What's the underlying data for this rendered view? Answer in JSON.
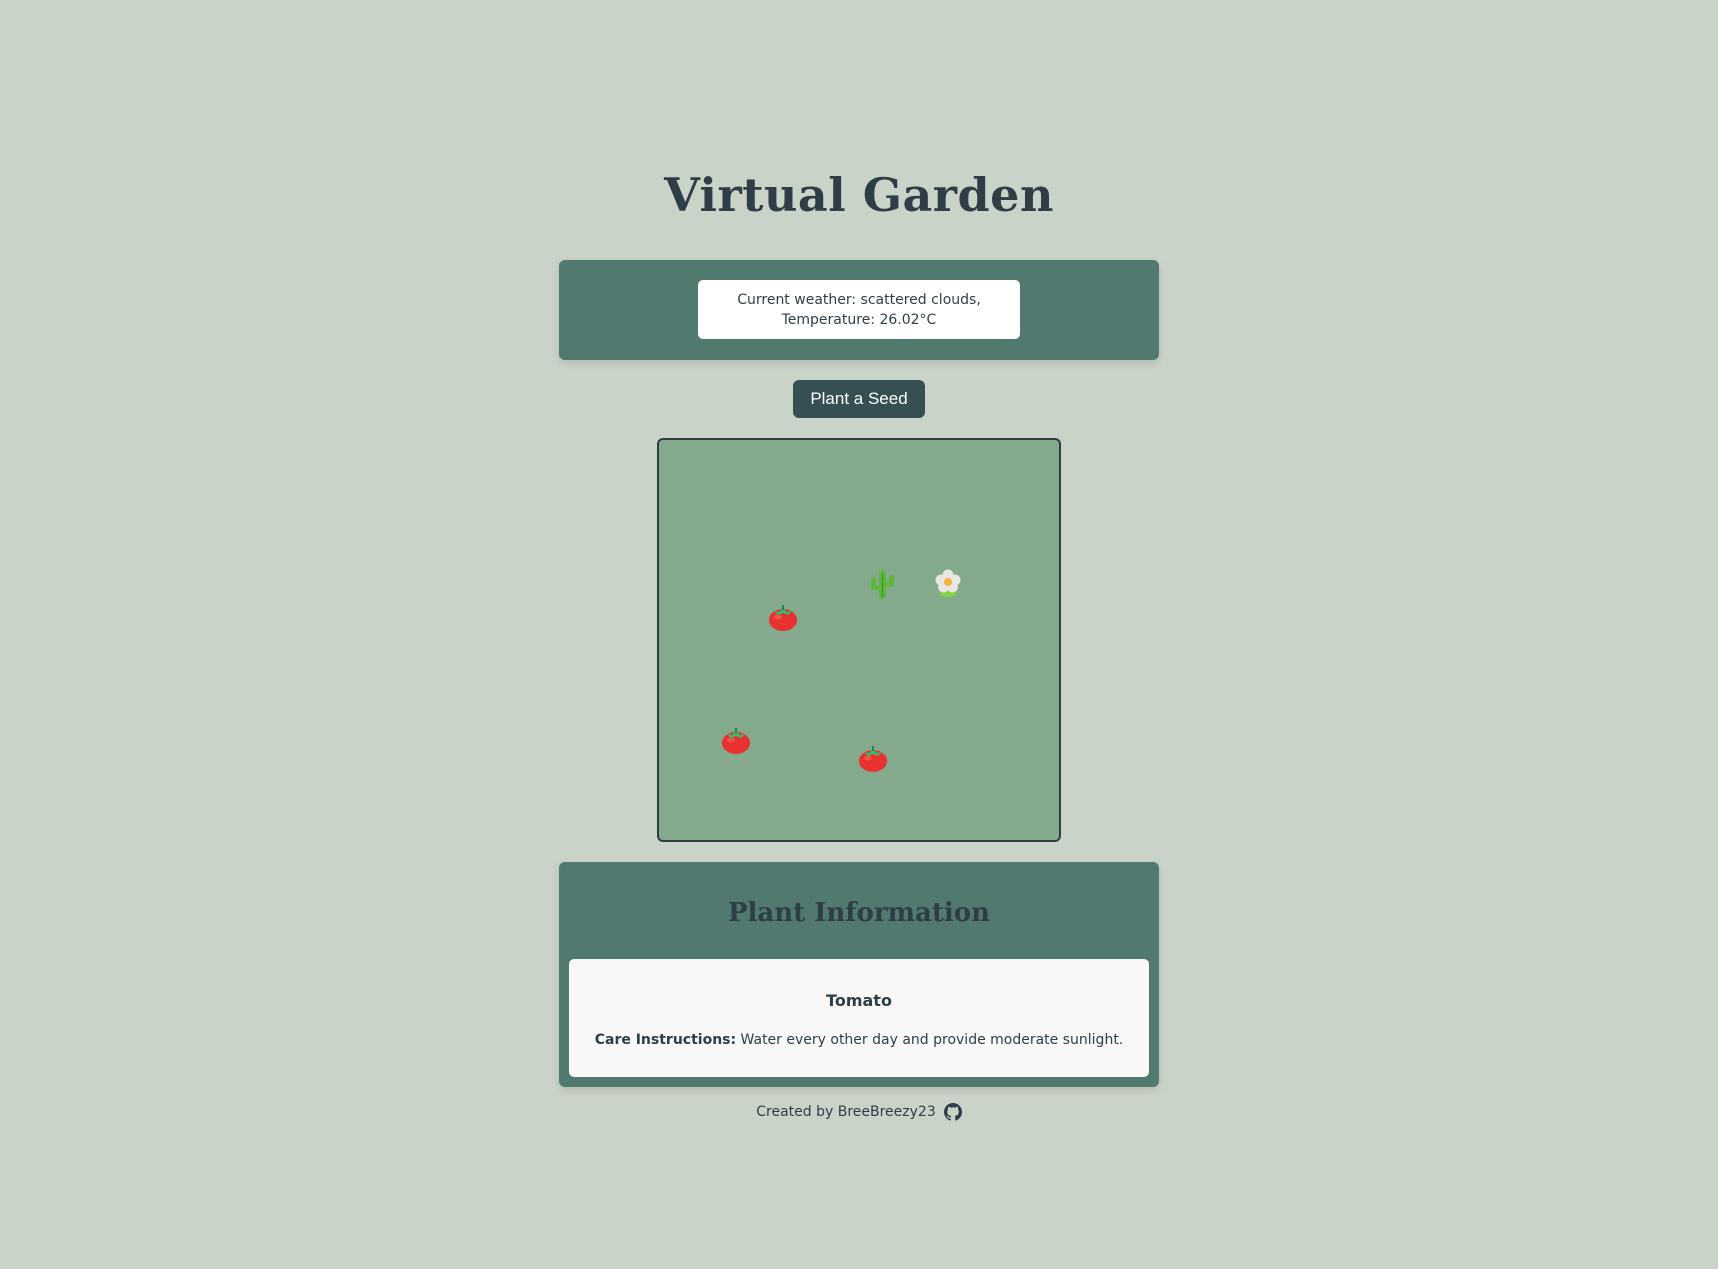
{
  "page": {
    "title": "Virtual Garden"
  },
  "weather": {
    "line1": "Current weather: scattered clouds,",
    "line2": "Temperature: 26.02°C"
  },
  "actions": {
    "plant_seed_label": "Plant a Seed"
  },
  "garden": {
    "plants": [
      {
        "type": "tomato",
        "icon": "tomato-icon"
      },
      {
        "type": "cactus",
        "icon": "cactus-icon"
      },
      {
        "type": "flower",
        "icon": "blossom-icon"
      },
      {
        "type": "tomato",
        "icon": "tomato-icon"
      },
      {
        "type": "tomato",
        "icon": "tomato-icon"
      }
    ]
  },
  "plant_info": {
    "heading": "Plant Information",
    "name": "Tomato",
    "care_label": "Care Instructions:",
    "care_text": " Water every other day and provide moderate sunlight."
  },
  "footer": {
    "credit": "Created by BreeBreezy23",
    "icon": "github-icon"
  },
  "colors": {
    "background": "#cad3c8",
    "panel": "#52796f",
    "garden": "#84a98c",
    "button": "#354f52",
    "text": "#2f3e46"
  }
}
